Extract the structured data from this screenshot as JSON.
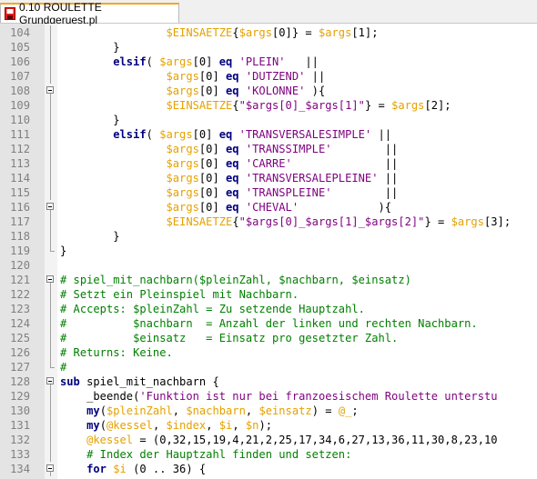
{
  "tab": {
    "title": "0.10 ROULETTE Grundgeruest.pl",
    "icon": "file-save-icon"
  },
  "colors": {
    "keyword": "#00007f",
    "variable": "#e5a100",
    "string": "#7f007f",
    "comment": "#007f00",
    "gutter": "#e4e4e4"
  },
  "lines": [
    {
      "n": "104",
      "fold": "line",
      "seg": [
        [
          "",
          "                "
        ],
        [
          "var",
          "$EINSAETZE"
        ],
        [
          "op",
          "{"
        ],
        [
          "var",
          "$args"
        ],
        [
          "op",
          "[0]} = "
        ],
        [
          "var",
          "$args"
        ],
        [
          "op",
          "[1];"
        ]
      ]
    },
    {
      "n": "105",
      "fold": "line",
      "seg": [
        [
          "",
          "        "
        ],
        [
          "op",
          "}"
        ]
      ]
    },
    {
      "n": "106",
      "fold": "line",
      "seg": [
        [
          "",
          "        "
        ],
        [
          "kw",
          "elsif"
        ],
        [
          "op",
          "( "
        ],
        [
          "var",
          "$args"
        ],
        [
          "op",
          "[0] "
        ],
        [
          "kw",
          "eq"
        ],
        [
          "op",
          " "
        ],
        [
          "str",
          "'PLEIN'"
        ],
        [
          "op",
          "   ||"
        ]
      ]
    },
    {
      "n": "107",
      "fold": "line",
      "seg": [
        [
          "",
          "                "
        ],
        [
          "var",
          "$args"
        ],
        [
          "op",
          "[0] "
        ],
        [
          "kw",
          "eq"
        ],
        [
          "op",
          " "
        ],
        [
          "str",
          "'DUTZEND'"
        ],
        [
          "op",
          " ||"
        ]
      ]
    },
    {
      "n": "108",
      "fold": "box",
      "seg": [
        [
          "",
          "                "
        ],
        [
          "var",
          "$args"
        ],
        [
          "op",
          "[0] "
        ],
        [
          "kw",
          "eq"
        ],
        [
          "op",
          " "
        ],
        [
          "str",
          "'KOLONNE'"
        ],
        [
          "op",
          " ){"
        ]
      ]
    },
    {
      "n": "109",
      "fold": "line",
      "seg": [
        [
          "",
          "                "
        ],
        [
          "var",
          "$EINSAETZE"
        ],
        [
          "op",
          "{"
        ],
        [
          "str",
          "\"$args[0]_$args[1]\""
        ],
        [
          "op",
          "} = "
        ],
        [
          "var",
          "$args"
        ],
        [
          "op",
          "[2];"
        ]
      ]
    },
    {
      "n": "110",
      "fold": "line",
      "seg": [
        [
          "",
          "        "
        ],
        [
          "op",
          "}"
        ]
      ]
    },
    {
      "n": "111",
      "fold": "line",
      "seg": [
        [
          "",
          "        "
        ],
        [
          "kw",
          "elsif"
        ],
        [
          "op",
          "( "
        ],
        [
          "var",
          "$args"
        ],
        [
          "op",
          "[0] "
        ],
        [
          "kw",
          "eq"
        ],
        [
          "op",
          " "
        ],
        [
          "str",
          "'TRANSVERSALESIMPLE'"
        ],
        [
          "op",
          " ||"
        ]
      ]
    },
    {
      "n": "112",
      "fold": "line",
      "seg": [
        [
          "",
          "                "
        ],
        [
          "var",
          "$args"
        ],
        [
          "op",
          "[0] "
        ],
        [
          "kw",
          "eq"
        ],
        [
          "op",
          " "
        ],
        [
          "str",
          "'TRANSSIMPLE'"
        ],
        [
          "op",
          "        ||"
        ]
      ]
    },
    {
      "n": "113",
      "fold": "line",
      "seg": [
        [
          "",
          "                "
        ],
        [
          "var",
          "$args"
        ],
        [
          "op",
          "[0] "
        ],
        [
          "kw",
          "eq"
        ],
        [
          "op",
          " "
        ],
        [
          "str",
          "'CARRE'"
        ],
        [
          "op",
          "              ||"
        ]
      ]
    },
    {
      "n": "114",
      "fold": "line",
      "seg": [
        [
          "",
          "                "
        ],
        [
          "var",
          "$args"
        ],
        [
          "op",
          "[0] "
        ],
        [
          "kw",
          "eq"
        ],
        [
          "op",
          " "
        ],
        [
          "str",
          "'TRANSVERSALEPLEINE'"
        ],
        [
          "op",
          " ||"
        ]
      ]
    },
    {
      "n": "115",
      "fold": "line",
      "seg": [
        [
          "",
          "                "
        ],
        [
          "var",
          "$args"
        ],
        [
          "op",
          "[0] "
        ],
        [
          "kw",
          "eq"
        ],
        [
          "op",
          " "
        ],
        [
          "str",
          "'TRANSPLEINE'"
        ],
        [
          "op",
          "        ||"
        ]
      ]
    },
    {
      "n": "116",
      "fold": "box",
      "seg": [
        [
          "",
          "                "
        ],
        [
          "var",
          "$args"
        ],
        [
          "op",
          "[0] "
        ],
        [
          "kw",
          "eq"
        ],
        [
          "op",
          " "
        ],
        [
          "str",
          "'CHEVAL'"
        ],
        [
          "op",
          "            ){"
        ]
      ]
    },
    {
      "n": "117",
      "fold": "line",
      "seg": [
        [
          "",
          "                "
        ],
        [
          "var",
          "$EINSAETZE"
        ],
        [
          "op",
          "{"
        ],
        [
          "str",
          "\"$args[0]_$args[1]_$args[2]\""
        ],
        [
          "op",
          "} = "
        ],
        [
          "var",
          "$args"
        ],
        [
          "op",
          "[3];"
        ]
      ]
    },
    {
      "n": "118",
      "fold": "line",
      "seg": [
        [
          "",
          "        "
        ],
        [
          "op",
          "}"
        ]
      ]
    },
    {
      "n": "119",
      "fold": "end",
      "seg": [
        [
          "op",
          "}"
        ]
      ]
    },
    {
      "n": "120",
      "fold": "none",
      "seg": []
    },
    {
      "n": "121",
      "fold": "box",
      "seg": [
        [
          "cmt",
          "# spiel_mit_nachbarn($pleinZahl, $nachbarn, $einsatz)"
        ]
      ]
    },
    {
      "n": "122",
      "fold": "line",
      "seg": [
        [
          "cmt",
          "# Setzt ein Pleinspiel mit Nachbarn."
        ]
      ]
    },
    {
      "n": "123",
      "fold": "line",
      "seg": [
        [
          "cmt",
          "# Accepts: $pleinZahl = Zu setzende Hauptzahl."
        ]
      ]
    },
    {
      "n": "124",
      "fold": "line",
      "seg": [
        [
          "cmt",
          "#          $nachbarn  = Anzahl der linken und rechten Nachbarn."
        ]
      ]
    },
    {
      "n": "125",
      "fold": "line",
      "seg": [
        [
          "cmt",
          "#          $einsatz   = Einsatz pro gesetzter Zahl."
        ]
      ]
    },
    {
      "n": "126",
      "fold": "line",
      "seg": [
        [
          "cmt",
          "# Returns: Keine."
        ]
      ]
    },
    {
      "n": "127",
      "fold": "end",
      "seg": [
        [
          "cmt",
          "#"
        ]
      ]
    },
    {
      "n": "128",
      "fold": "box",
      "seg": [
        [
          "kw",
          "sub"
        ],
        [
          "op",
          " spiel_mit_nachbarn {"
        ]
      ]
    },
    {
      "n": "129",
      "fold": "line",
      "seg": [
        [
          "",
          "    "
        ],
        [
          "op",
          "_beende("
        ],
        [
          "str",
          "'Funktion ist nur bei franzoesischem Roulette unterstu"
        ]
      ]
    },
    {
      "n": "130",
      "fold": "line",
      "seg": [
        [
          "",
          "    "
        ],
        [
          "kw",
          "my"
        ],
        [
          "op",
          "("
        ],
        [
          "var",
          "$pleinZahl"
        ],
        [
          "op",
          ", "
        ],
        [
          "var",
          "$nachbarn"
        ],
        [
          "op",
          ", "
        ],
        [
          "var",
          "$einsatz"
        ],
        [
          "op",
          ") = "
        ],
        [
          "var",
          "@_"
        ],
        [
          "op",
          ";"
        ]
      ]
    },
    {
      "n": "131",
      "fold": "line",
      "seg": [
        [
          "",
          "    "
        ],
        [
          "kw",
          "my"
        ],
        [
          "op",
          "("
        ],
        [
          "var",
          "@kessel"
        ],
        [
          "op",
          ", "
        ],
        [
          "var",
          "$index"
        ],
        [
          "op",
          ", "
        ],
        [
          "var",
          "$i"
        ],
        [
          "op",
          ", "
        ],
        [
          "var",
          "$n"
        ],
        [
          "op",
          ");"
        ]
      ]
    },
    {
      "n": "132",
      "fold": "line",
      "seg": [
        [
          "",
          "    "
        ],
        [
          "var",
          "@kessel"
        ],
        [
          "op",
          " = (0,32,15,19,4,21,2,25,17,34,6,27,13,36,11,30,8,23,10"
        ]
      ]
    },
    {
      "n": "133",
      "fold": "line",
      "seg": [
        [
          "",
          "    "
        ],
        [
          "cmt",
          "# Index der Hauptzahl finden und setzen:"
        ]
      ]
    },
    {
      "n": "134",
      "fold": "box",
      "seg": [
        [
          "",
          "    "
        ],
        [
          "kw",
          "for"
        ],
        [
          "op",
          " "
        ],
        [
          "var",
          "$i"
        ],
        [
          "op",
          " (0 .. 36) {"
        ]
      ]
    }
  ]
}
